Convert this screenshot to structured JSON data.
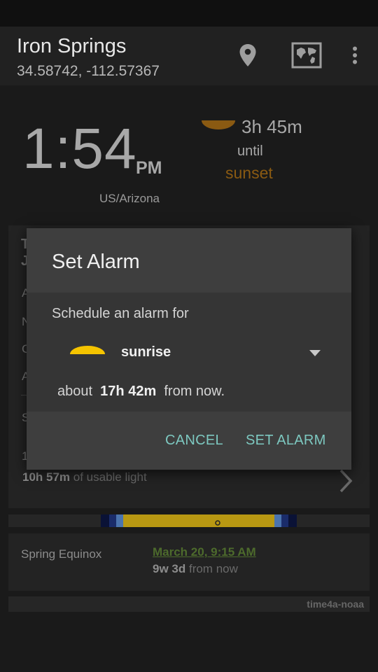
{
  "header": {
    "title": "Iron Springs",
    "coordinates": "34.58742, -112.57367",
    "actions": [
      "location-pin-icon",
      "world-map-icon",
      "overflow-menu-icon"
    ]
  },
  "clock": {
    "time": "1:54",
    "ampm": "PM",
    "timezone": "US/Arizona"
  },
  "next_event": {
    "duration": "3h 45m",
    "until": "until",
    "name": "sunset",
    "icon": "sunset-icon",
    "color": "#8a5a12"
  },
  "card_peek": {
    "lines": [
      "T",
      "J",
      "A",
      "N",
      "C",
      "A",
      "S",
      "1"
    ],
    "usable_light_value": "10h 57m",
    "usable_light_suffix": " of usable light"
  },
  "equinox": {
    "label": "Spring Equinox",
    "date": "March 20, 9:15 AM",
    "relative_value": "9w 3d",
    "relative_suffix": " from now"
  },
  "footer": {
    "brand": "time4a-noaa"
  },
  "dialog": {
    "title": "Set Alarm",
    "message": "Schedule an alarm for",
    "selected_event": "sunrise",
    "selected_icon": "sunrise-icon",
    "note_prefix": "about  ",
    "note_value": "17h 42m",
    "note_suffix": "  from now.",
    "cancel_label": "CANCEL",
    "confirm_label": "SET ALARM",
    "accent_color": "#7dc8c0",
    "sun_color": "#f5c400"
  }
}
